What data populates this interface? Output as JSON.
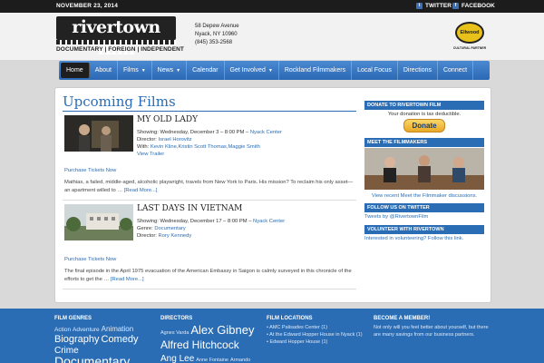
{
  "topbar": {
    "date": "NOVEMBER 23, 2014",
    "twitter": "TWITTER",
    "facebook": "FACEBOOK"
  },
  "header": {
    "logo_word": "rivertown film",
    "logo_tagline": "DOCUMENTARY | FOREIGN | INDEPENDENT",
    "address_line1": "58 Depew Avenue",
    "address_line2": "Nyack, NY 10960",
    "phone": "(845) 353-2568",
    "sponsor_name": "Ellwood",
    "sponsor_caption": "CULTURAL PARTNER"
  },
  "nav": {
    "items": [
      {
        "label": "Home",
        "active": true,
        "dropdown": false
      },
      {
        "label": "About",
        "dropdown": false
      },
      {
        "label": "Films",
        "dropdown": true
      },
      {
        "label": "News",
        "dropdown": true
      },
      {
        "label": "Calendar",
        "dropdown": false
      },
      {
        "label": "Get Involved",
        "dropdown": true
      },
      {
        "label": "Rockland Filmmakers",
        "dropdown": false
      },
      {
        "label": "Local Focus",
        "dropdown": false
      },
      {
        "label": "Directions",
        "dropdown": false
      },
      {
        "label": "Connect",
        "dropdown": false
      }
    ]
  },
  "main": {
    "title": "Upcoming Films",
    "films": [
      {
        "title": "MY OLD LADY",
        "showing_label": "Showing: Wednesday, December 3 – 8:00 PM –",
        "venue": "Nyack Center",
        "director_label": "Director:",
        "director": "Israel Horovitz",
        "with_label": "With:",
        "cast": "Kevin Kline,Kristin Scott Thomas,Maggie Smith",
        "trailer": "View Trailer",
        "buy": "Purchase Tickets Now",
        "desc": "Mathias, a failed, middle-aged, alcoholic playwright, travels from New York to Paris. His mission? To reclaim his only asset—an apartment willed to …",
        "read_more": "[Read More...]"
      },
      {
        "title": "LAST DAYS IN VIETNAM",
        "showing_label": "Showing: Wednesday, December 17 – 8:00 PM –",
        "venue": "Nyack Center",
        "genre_label": "Genre:",
        "genre": "Documentary",
        "director_label": "Director:",
        "director": "Rory Kennedy",
        "buy": "Purchase Tickets Now",
        "desc": "The final episode in the April 1975 evacuation of the American Embassy in Saigon is calmly surveyed in this chronicle of the efforts to get the …",
        "read_more": "[Read More...]"
      }
    ]
  },
  "sidebar": {
    "donate_header": "DONATE TO RIVERTOWN FILM",
    "donate_text": "Your donation is tax deductible.",
    "donate_button": "Donate",
    "filmmakers_header": "MEET THE FILMMAKERS",
    "filmmakers_link": "View recent Meet the Filmmaker discussions.",
    "twitter_header": "FOLLOW US ON TWITTER",
    "twitter_link": "Tweets by @RivertownFilm",
    "volunteer_header": "VOLUNTEER WITH RIVERTOWN",
    "volunteer_link": "Interested in volunteering? Follow this link."
  },
  "footer": {
    "genres_header": "FILM GENRES",
    "genres": [
      "Action",
      "Adventure",
      "Animation",
      "Biography",
      "Comedy",
      "Crime",
      "Documentary"
    ],
    "directors_header": "DIRECTORS",
    "directors": [
      "Agnes Varda",
      "Alex Gibney",
      "Alfred Hitchcock",
      "Ang Lee",
      "Anne Fontaine",
      "Armando"
    ],
    "locations_header": "FILM LOCATIONS",
    "locations": [
      "AMC Palisades Center (1)",
      "At the Edward Hopper House in Nyack (1)",
      "Edward Hopper House (1)"
    ],
    "member_header": "BECOME A MEMBER!",
    "member_text": "Not only will you feel better about yourself, but there are many savings from our business partners."
  }
}
